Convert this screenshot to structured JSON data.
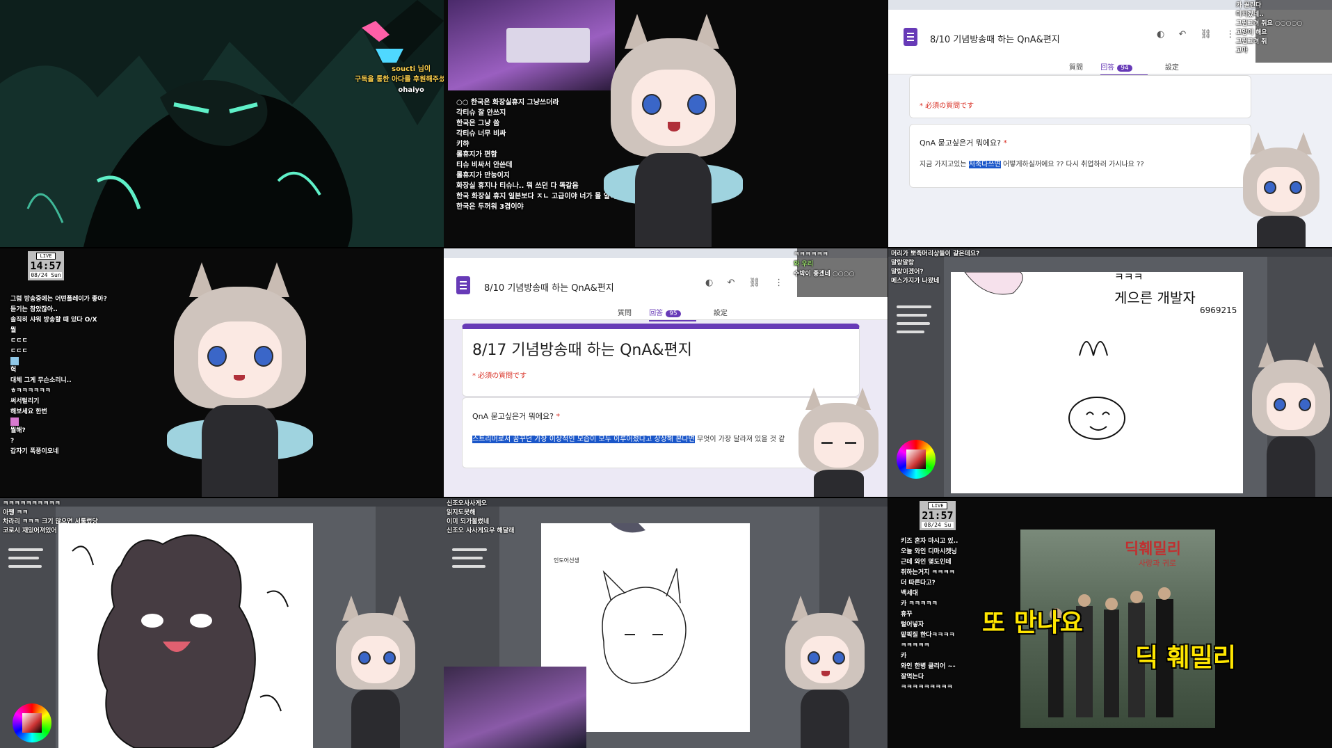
{
  "tile1": {
    "chat": [
      "soucti 님이",
      "구독을 통한 아다를 후원해주셨습니다!",
      "ohaiyo"
    ]
  },
  "tile2": {
    "chat": [
      "○○ 한국은 화장실휴지 그냥쓰더라",
      "각티슈 잘 안쓰지",
      "한국은 그냥 씀",
      "각티슈 너무 비싸",
      "키햐",
      "롤휴지가 편함",
      "티슈 비싸서 안쓴데",
      "롤휴지가 만능이지",
      "화장실 휴지나 티슈나.. 뭐 쓰던 다 똑같음",
      "한국 화장실 휴지 일본보다 ㅈㄴ 고급이야 너가 몰 알아",
      "한국은 두꺼워 3겹이야"
    ]
  },
  "tile3": {
    "form_title": "8/10 기념방송때 하는 QnA&편지",
    "tabs": [
      "質問",
      "回答",
      "設定"
    ],
    "answer_count": "94",
    "required_note": "* 必須の質問です",
    "question": "QnA 묻고싶은거 뭐에요?",
    "answer_highlight": "저축다쓰면",
    "answer_before": "지금 가지고있는 ",
    "answer_after": " 어떻게하실꺼에요 ?? 다시 취업하러 가시나요 ??",
    "chat": [
      "카 꼴린다",
      "미치겠네..",
      "그림그려 줘요 ○○○○○",
      "고양이 해요",
      "그림그려 줘",
      "고마"
    ]
  },
  "tile4": {
    "live_label": "LIVE",
    "time": "14:57",
    "date": "08/24 Sun",
    "chat": [
      "그럼 방송중에는 어떤플레이가 좋아?",
      "듣기는 참았잖아..",
      "솔직히 샤워 방송할 때 있다 O/X",
      "뭘",
      "ㄷㄷㄷ",
      "ㄷㄷㄷ",
      "",
      "헉",
      "대체 그게 무슨소리니..",
      "ㅎㅋㅋㅋㅋㅋㅋ",
      "써서털리기",
      "해보세요 한번",
      "",
      "뭘해?",
      "?",
      "갑자기 폭풍이오네"
    ]
  },
  "tile5": {
    "form_title": "8/10 기념방송때 하는 QnA&편지",
    "tabs": [
      "質問",
      "回答",
      "設定"
    ],
    "answer_count": "95",
    "header_title": "8/17 기념방송때 하는 QnA&편지",
    "required_note": "* 必須の質問です",
    "question": "QnA 묻고싶은거 뭐에요?",
    "answer_highlight": "스트리머로서 꿈꾸던 가장 이상적인 모습이 모두 이루어졌다고 상상해 본다면",
    "answer_after": " 무엇이 가장 달라져 있을 것 같",
    "chat": [
      "ㅋㅋㅋㅋㅋㅋ",
      "와 우리",
      "수박이 좋겠네 ○○○○"
    ]
  },
  "tile6": {
    "chat": [
      "머리가 뽀족머리상들이 같은데요?",
      "말랑말랑",
      "말랑이겠어?",
      "메스가지가 나왔네"
    ],
    "drawing_text1": "ㅋㅋㅋ",
    "drawing_text2": "게으른 개발자",
    "drawing_text3": "6969215"
  },
  "tile7": {
    "chat": [
      "ㅋㅋㅋㅋㅋㅋㅋㅋㅋㅋ",
      "아쨍 ㅋㅋ",
      "차라리 ㅋㅋㅋ 크기 많으면 서툴렀당",
      "코로시 재밌어져있어"
    ]
  },
  "tile8": {
    "chat": [
      "신조오사사게오",
      "읽지도못해",
      "이미 되가볼렀네",
      "신조오 사사게요우 해달래"
    ],
    "canvas_note": "인도어선생"
  },
  "tile9": {
    "live_label": "LIVE",
    "time": "21:57",
    "date": "08/24 Su",
    "chat": [
      "키즈 혼자 마시고 있..",
      "오늘 와인 디마시켓닝",
      "근데 와인 몇도인데",
      "취하는거지 ㅋㅋㅋㅋ",
      "더 따른다고?",
      "백세대",
      "카 ㅋㅋㅋㅋㅋ",
      "휴꾸",
      "털어넣자",
      "맡픽질 한다ㅋㅋㅋㅋ",
      "ㅋㅋㅋㅋㅋ",
      "카",
      "와인 한병 클리어 ~-",
      "잘먹는다",
      "ㅋㅋㅋㅋㅋㅋㅋㅋㅋ"
    ],
    "album_title": "딕훼밀리",
    "album_sub": "사랑과 귀로",
    "caption_left": "또 만나요",
    "caption_right": "딕 훼밀리"
  }
}
